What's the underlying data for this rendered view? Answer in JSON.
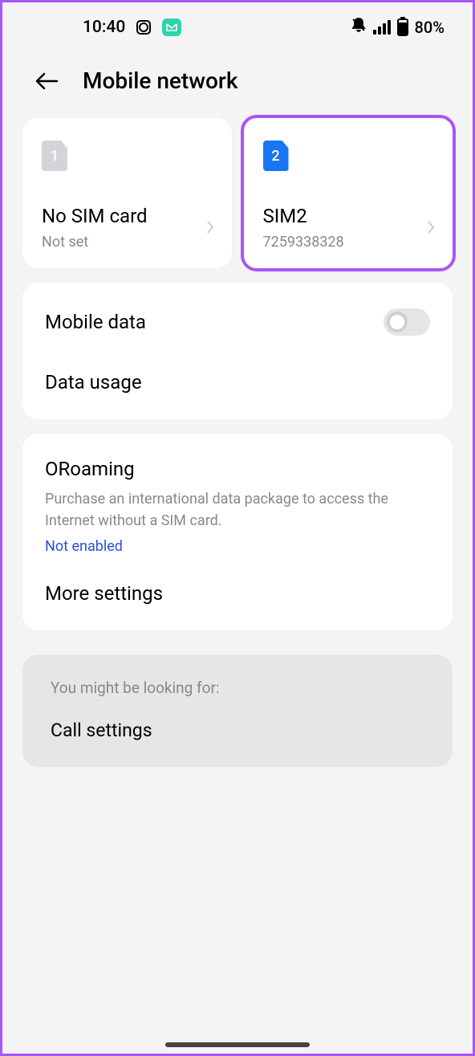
{
  "statusBar": {
    "time": "10:40",
    "battery": "80%"
  },
  "header": {
    "title": "Mobile network"
  },
  "simCards": [
    {
      "number": "1",
      "title": "No SIM card",
      "subtitle": "Not set"
    },
    {
      "number": "2",
      "title": "SIM2",
      "subtitle": "7259338328"
    }
  ],
  "dataSection": {
    "mobileData": "Mobile data",
    "dataUsage": "Data usage"
  },
  "roaming": {
    "title": "ORoaming",
    "description": "Purchase an international data package to access the Internet without a SIM card.",
    "status": "Not enabled",
    "moreSettings": "More settings"
  },
  "suggestion": {
    "label": "You might be looking for:",
    "link": "Call settings"
  }
}
